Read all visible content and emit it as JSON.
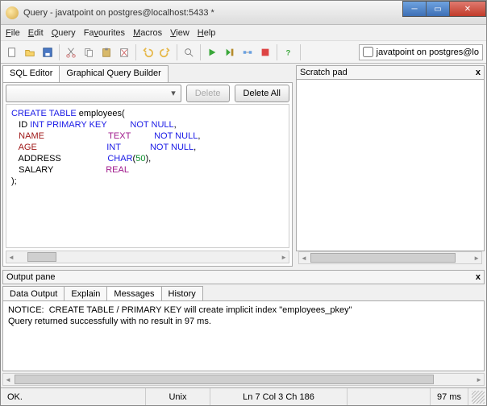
{
  "window": {
    "title": "Query - javatpoint on postgres@localhost:5433 *"
  },
  "menu": {
    "file": "File",
    "edit": "Edit",
    "query": "Query",
    "favourites": "Favourites",
    "macros": "Macros",
    "view": "View",
    "help": "Help"
  },
  "connection": {
    "label": "javatpoint on postgres@lo"
  },
  "editor": {
    "tab_sql": "SQL Editor",
    "tab_gqb": "Graphical Query Builder",
    "delete_btn": "Delete",
    "delete_all_btn": "Delete All",
    "code": {
      "l1a": "CREATE TABLE",
      "l1b": " employees(",
      "l2a": "   ID ",
      "l2b": "INT PRIMARY KEY",
      "l2c": "NOT NULL",
      "l2d": ",",
      "l3a": "   ",
      "l3b": "NAME",
      "l3c": "TEXT",
      "l3d": "NOT NULL",
      "l3e": ",",
      "l4a": "   ",
      "l4b": "AGE",
      "l4c": "INT",
      "l4d": "NOT NULL",
      "l4e": ",",
      "l5a": "   ADDRESS",
      "l5b": "CHAR",
      "l5c": "(",
      "l5d": "50",
      "l5e": "),",
      "l6a": "   SALARY",
      "l6b": "REAL",
      "l7": ");"
    }
  },
  "scratch": {
    "title": "Scratch pad"
  },
  "output": {
    "title": "Output pane",
    "tab_data": "Data Output",
    "tab_explain": "Explain",
    "tab_messages": "Messages",
    "tab_history": "History",
    "line1": "NOTICE:  CREATE TABLE / PRIMARY KEY will create implicit index \"employees_pkey\"",
    "line2": "Query returned successfully with no result in 97 ms."
  },
  "status": {
    "ok": "OK.",
    "encoding": "Unix",
    "position": "Ln 7 Col 3 Ch 186",
    "time": "97 ms"
  }
}
